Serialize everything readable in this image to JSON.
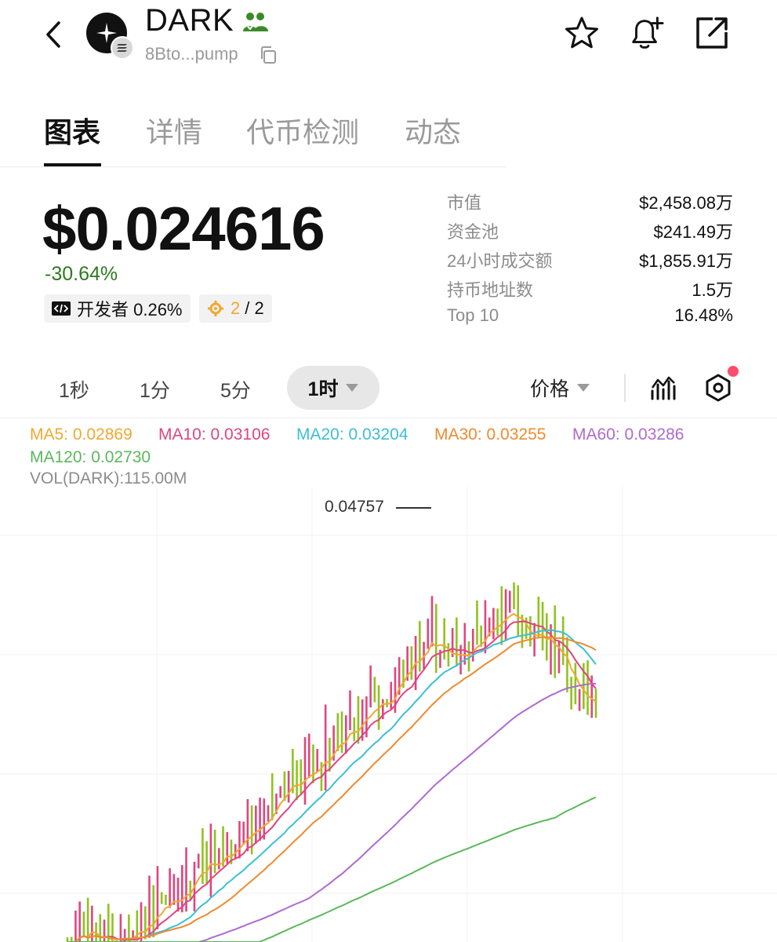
{
  "header": {
    "token_name": "DARK",
    "address": "8Bto...pump"
  },
  "tabs": [
    {
      "label": "图表",
      "active": true
    },
    {
      "label": "详情",
      "active": false
    },
    {
      "label": "代币检测",
      "active": false
    },
    {
      "label": "动态",
      "active": false
    }
  ],
  "price": {
    "value": "$0.024616",
    "change": "-30.64%",
    "dev_label": "开发者 0.26%",
    "snipers_value": "2",
    "snipers_total": "/ 2"
  },
  "stats": [
    {
      "label": "市值",
      "value": "$2,458.08万"
    },
    {
      "label": "资金池",
      "value": "$241.49万"
    },
    {
      "label": "24小时成交额",
      "value": "$1,855.91万"
    },
    {
      "label": "持币地址数",
      "value": "1.5万"
    },
    {
      "label": "Top 10",
      "value": "16.48%"
    }
  ],
  "intervals": {
    "options": [
      "1秒",
      "1分",
      "5分"
    ],
    "active": "1时",
    "price_mode": "价格"
  },
  "ma_legend": [
    {
      "text": "MA5: 0.02869",
      "color": "#f0a830"
    },
    {
      "text": "MA10: 0.03106",
      "color": "#e0457f"
    },
    {
      "text": "MA20: 0.03204",
      "color": "#3cbfd6"
    },
    {
      "text": "MA30: 0.03255",
      "color": "#f08a2e"
    },
    {
      "text": "MA60: 0.03286",
      "color": "#b06ad0"
    },
    {
      "text": "MA120: 0.02730",
      "color": "#5cb85c"
    }
  ],
  "volume_label": "VOL(DARK):115.00M",
  "max_price_label": "0.04757",
  "colors": {
    "up": "#e0457f",
    "down": "#8fc31f",
    "change_text": "#2e7a1f",
    "community": "#3b8a2a"
  }
}
